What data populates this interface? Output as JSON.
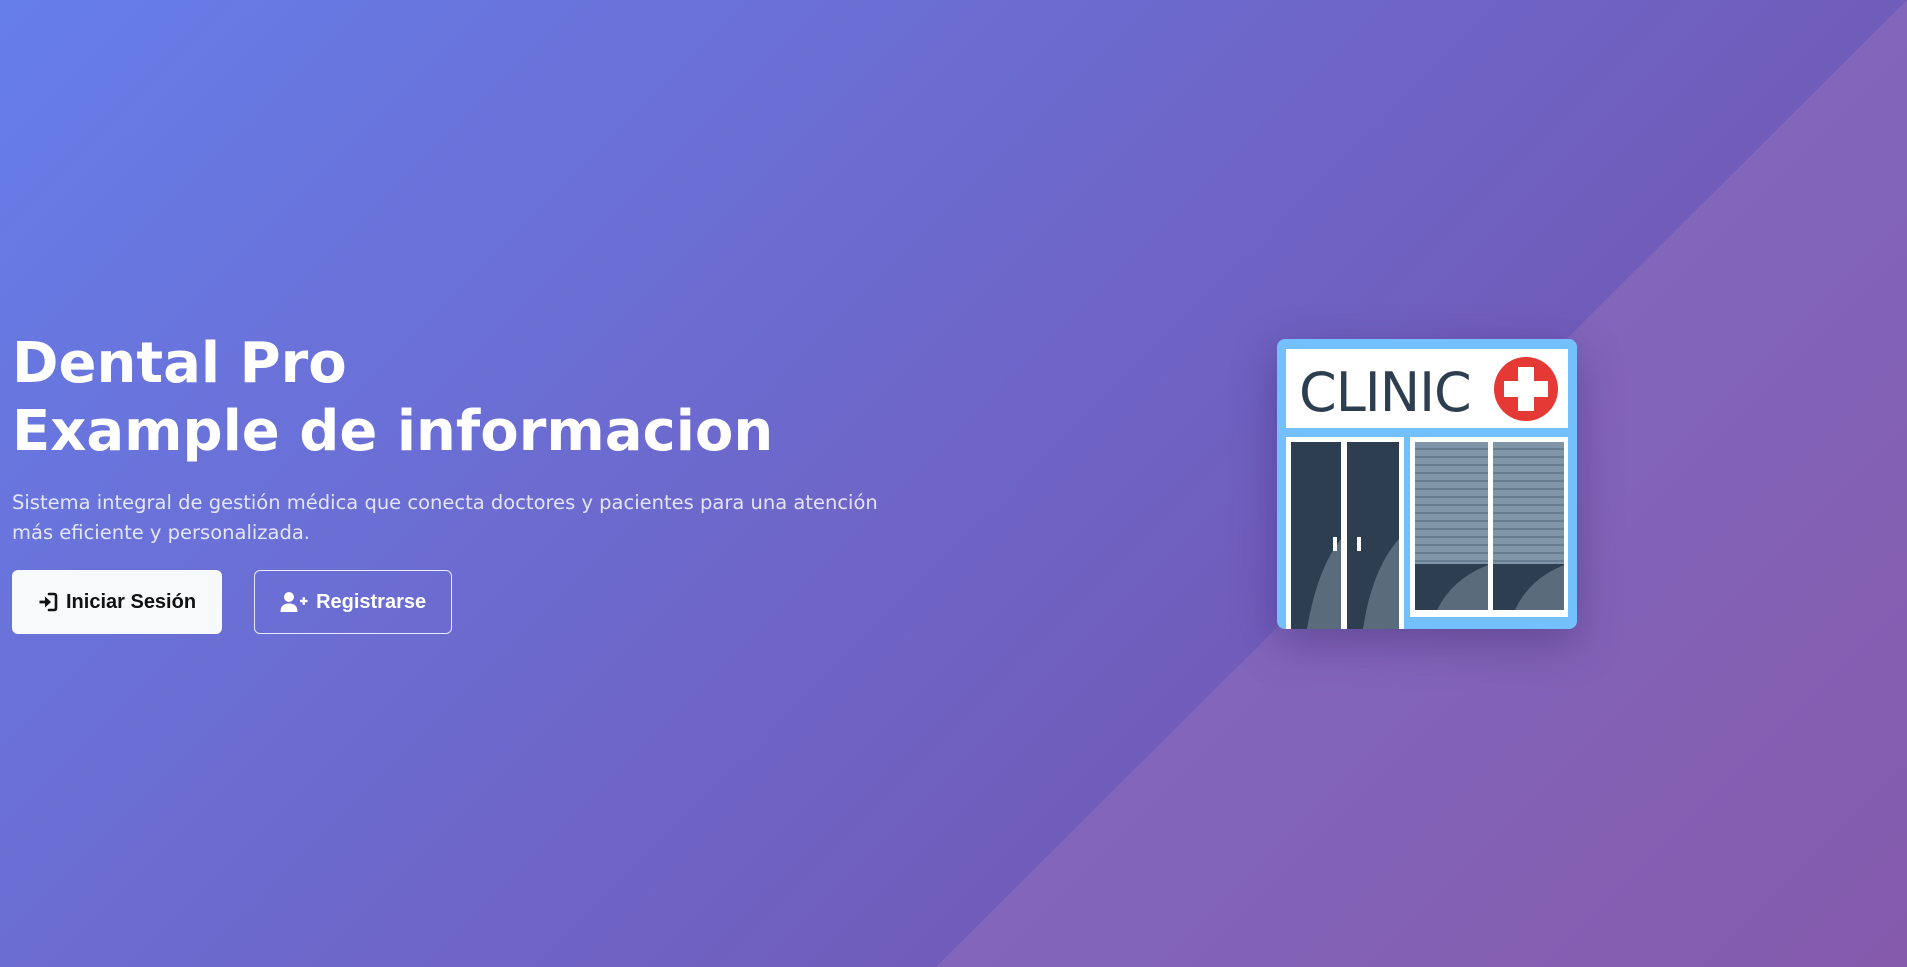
{
  "hero": {
    "title_line1": "Dental Pro",
    "title_line2": "Example de informacion",
    "description": "Sistema integral de gestión médica que conecta doctores y pacientes para una atención más eficiente y personalizada.",
    "login_button": {
      "label": "Iniciar Sesión",
      "icon": "sign-in-icon"
    },
    "register_button": {
      "label": "Registrarse",
      "icon": "user-plus-icon"
    }
  },
  "illustration": {
    "sign_text": "CLINIC",
    "icon": "medical-cross-icon"
  },
  "colors": {
    "gradient_start": "#667eea",
    "gradient_end": "#764ba2",
    "clinic_frame": "#74c0fc",
    "clinic_dark": "#2c3e50",
    "cross_red": "#e53935"
  }
}
